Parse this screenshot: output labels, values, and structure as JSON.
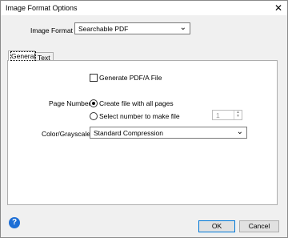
{
  "window": {
    "title": "Image Format Options",
    "close_glyph": "✕"
  },
  "image_format": {
    "label": "Image Format :",
    "value": "Searchable PDF",
    "chevron": "⌄"
  },
  "tabs": [
    {
      "label": "General"
    },
    {
      "label": "Text"
    }
  ],
  "general": {
    "pdfa_label": "Generate PDF/A File",
    "pdfa_checked": false,
    "page_number": {
      "label": "Page Number :",
      "option_all": "Create file with all pages",
      "option_select": "Select number to make file",
      "selected": "all",
      "spin_value": "1"
    },
    "color": {
      "label": "Color/Grayscale :",
      "value": "Standard Compression",
      "chevron": "⌄"
    }
  },
  "footer": {
    "help_glyph": "?",
    "ok_label": "OK",
    "cancel_label": "Cancel"
  }
}
